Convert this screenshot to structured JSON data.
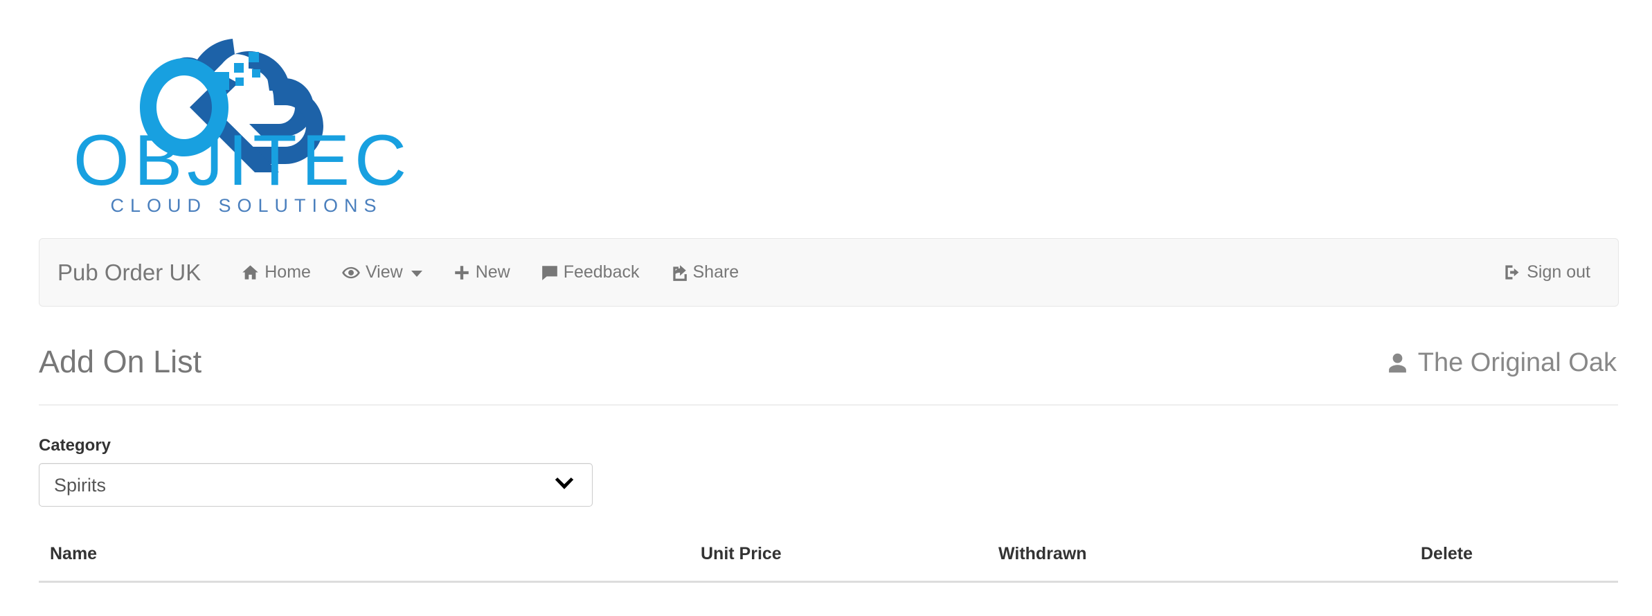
{
  "logo": {
    "wordmark": "OBJITEC",
    "tagline": "CLOUD SOLUTIONS",
    "colors": {
      "light_blue": "#18a0e0",
      "dark_blue": "#1d62a8",
      "tagline_blue": "#4a7fbd"
    },
    "icon_name": "cloud-logo-icon"
  },
  "navbar": {
    "brand": "Pub Order UK",
    "items": [
      {
        "label": "Home",
        "icon": "home-icon"
      },
      {
        "label": "View",
        "icon": "eye-icon",
        "caret": true
      },
      {
        "label": "New",
        "icon": "plus-icon"
      },
      {
        "label": "Feedback",
        "icon": "comment-icon"
      },
      {
        "label": "Share",
        "icon": "share-icon"
      }
    ],
    "sign_out": {
      "label": "Sign out",
      "icon": "sign-out-icon"
    },
    "background_color": "#f8f8f8",
    "text_color": "#777777"
  },
  "page": {
    "title": "Add On List",
    "user": {
      "name": "The Original Oak",
      "icon": "user-icon"
    }
  },
  "form": {
    "category": {
      "label": "Category",
      "selected": "Spirits",
      "options": [
        "Spirits"
      ]
    }
  },
  "table": {
    "columns": [
      "Name",
      "Unit Price",
      "Withdrawn",
      "Delete"
    ],
    "rows": []
  }
}
